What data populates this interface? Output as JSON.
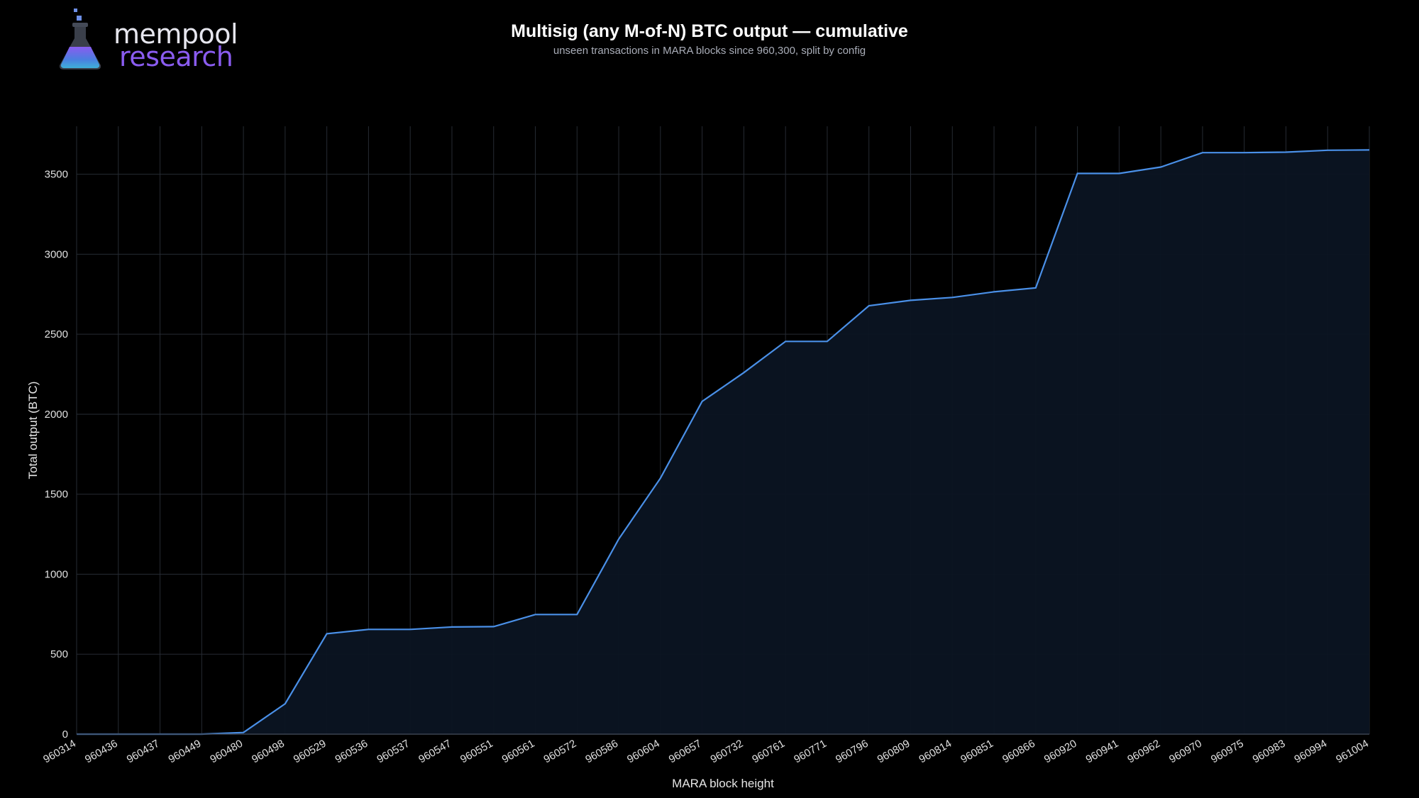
{
  "brand": {
    "line1": "mempool",
    "line2": "research"
  },
  "colors": {
    "background": "#000000",
    "line": "#4a90e8",
    "area": "#0b1422",
    "grid": "#262b33",
    "accent_purple": "#8a5cf0"
  },
  "chart_data": {
    "type": "area",
    "title": "Multisig (any M-of-N) BTC output — cumulative",
    "subtitle": "unseen transactions in MARA blocks since 960,300, split by config",
    "xlabel": "MARA block height",
    "ylabel": "Total output (BTC)",
    "ylim": [
      0,
      3800
    ],
    "yticks": [
      0,
      500,
      1000,
      1500,
      2000,
      2500,
      3000,
      3500
    ],
    "grid": true,
    "categories": [
      "960314",
      "960436",
      "960437",
      "960449",
      "960480",
      "960498",
      "960529",
      "960536",
      "960537",
      "960547",
      "960551",
      "960561",
      "960572",
      "960586",
      "960604",
      "960657",
      "960732",
      "960761",
      "960771",
      "960796",
      "960809",
      "960814",
      "960851",
      "960866",
      "960920",
      "960941",
      "960962",
      "960970",
      "960975",
      "960983",
      "960994",
      "961004"
    ],
    "values": [
      0,
      0,
      0,
      0,
      10,
      190,
      628,
      655,
      655,
      670,
      672,
      748,
      748,
      1220,
      1600,
      2080,
      2260,
      2455,
      2455,
      2678,
      2712,
      2730,
      2765,
      2790,
      3505,
      3505,
      3545,
      3635,
      3635,
      3638,
      3650,
      3652
    ]
  }
}
